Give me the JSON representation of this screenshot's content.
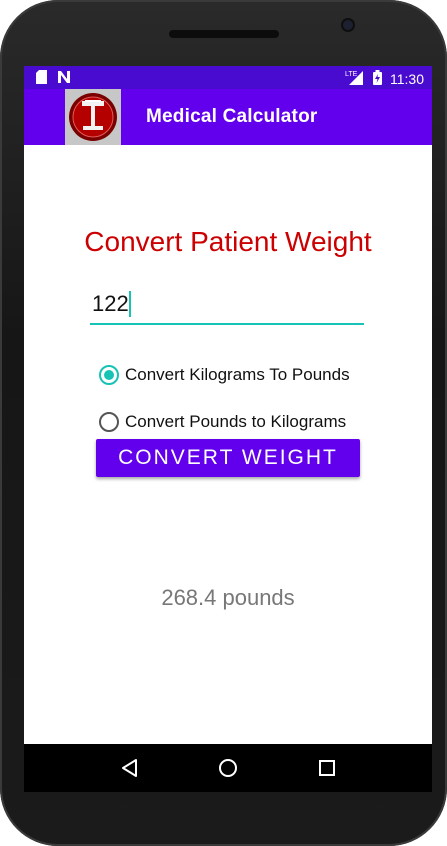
{
  "status_bar": {
    "time": "11:30",
    "network": "LTE",
    "icons": [
      "sd-card-icon",
      "notification-n-icon",
      "signal-icon",
      "battery-charging-icon"
    ]
  },
  "app_bar": {
    "title": "Medical Calculator",
    "icon": "scale-app-icon"
  },
  "main": {
    "heading": "Convert Patient Weight",
    "weight_input": {
      "value": "122",
      "placeholder": ""
    },
    "options": [
      {
        "label": "Convert Kilograms To Pounds",
        "checked": true
      },
      {
        "label": "Convert Pounds to Kilograms",
        "checked": false
      }
    ],
    "convert_button": "CONVERT WEIGHT",
    "result": "268.4 pounds"
  },
  "nav_bar": {
    "buttons": [
      "back-icon",
      "home-icon",
      "recents-icon"
    ]
  },
  "colors": {
    "primary": "#6200ee",
    "status_bar": "#4a0bd0",
    "accent": "#17c3b5",
    "heading": "#cc0000",
    "result_text": "#777777"
  }
}
